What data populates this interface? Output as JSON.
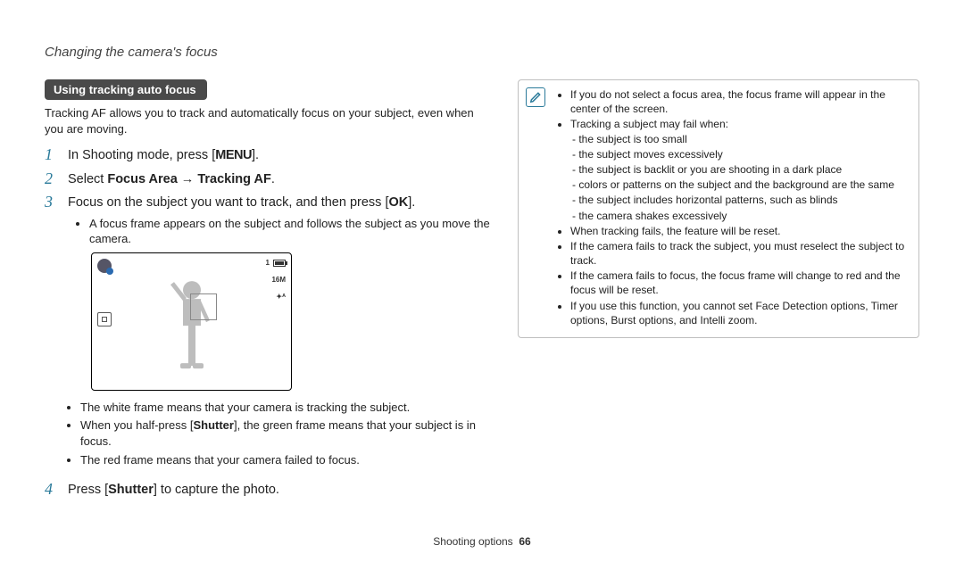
{
  "header": {
    "title": "Changing the camera's focus"
  },
  "section": {
    "pill": "Using tracking auto focus",
    "intro": "Tracking AF allows you to track and automatically focus on your subject, even when you are moving."
  },
  "steps": {
    "s1": {
      "num": "1",
      "pre": "In Shooting mode, press [",
      "btn": "MENU",
      "post": "]."
    },
    "s2": {
      "num": "2",
      "pre": "Select ",
      "bold1": "Focus Area",
      "arrow": " → ",
      "bold2": "Tracking AF",
      "post": "."
    },
    "s3": {
      "num": "3",
      "pre": "Focus on the subject you want to track, and then press [",
      "btn": "OK",
      "post": "].",
      "sub1": "A focus frame appears on the subject and follows the subject as you move the camera."
    },
    "s4": {
      "num": "4",
      "pre": "Press [",
      "bold": "Shutter",
      "post": "] to capture the photo."
    }
  },
  "screen": {
    "one": "1",
    "res": "16M",
    "flash": "✦ᴬ"
  },
  "frame_notes": {
    "n1": "The white frame means that your camera is tracking the subject.",
    "n2a": "When you half-press [",
    "n2b": "Shutter",
    "n2c": "], the green frame means that your subject is in focus.",
    "n3": "The red frame means that your camera failed to focus."
  },
  "note": {
    "b1": "If you do not select a focus area, the focus frame will appear in the center of the screen.",
    "b2": "Tracking a subject may fail when:",
    "b2_1": "the subject is too small",
    "b2_2": "the subject moves excessively",
    "b2_3": "the subject is backlit or you are shooting in a dark place",
    "b2_4": "colors or patterns on the subject and the background are the same",
    "b2_5": "the subject includes horizontal patterns, such as blinds",
    "b2_6": "the camera shakes excessively",
    "b3": "When tracking fails, the feature will be reset.",
    "b4": "If the camera fails to track the subject, you must reselect the subject to track.",
    "b5": "If the camera fails to focus, the focus frame will change to red and the focus will be reset.",
    "b6": "If you use this function, you cannot set Face Detection options, Timer options, Burst options, and Intelli zoom."
  },
  "footer": {
    "section": "Shooting options",
    "page": "66"
  }
}
